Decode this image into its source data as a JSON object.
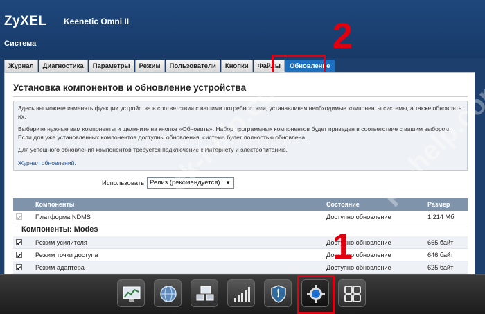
{
  "header": {
    "logo": "ZyXEL",
    "model": "Keenetic Omni II",
    "section": "Система"
  },
  "tabs": [
    {
      "label": "Журнал"
    },
    {
      "label": "Диагностика"
    },
    {
      "label": "Параметры"
    },
    {
      "label": "Режим"
    },
    {
      "label": "Пользователи"
    },
    {
      "label": "Кнопки"
    },
    {
      "label": "Файлы"
    },
    {
      "label": "Обновление"
    }
  ],
  "annotations": {
    "tab_marker": "2",
    "dock_marker": "1",
    "color": "#e00010"
  },
  "main": {
    "heading": "Установка компонентов и обновление устройства",
    "info": {
      "p1": "Здесь вы можете изменять функции устройства в соответствии с вашими потребностями, устанавливая необходимые компоненты системы, а также обновлять их.",
      "p2": "Выберите нужные вам компоненты и щелкните на кнопке «Обновить». Набор программных компонентов будет приведен в соответствие с вашим выбором. Если для уже установленных компонентов доступны обновления, система будет полностью обновлена.",
      "p3": "Для успешного обновления компонентов требуется подключение к Интернету и электропитанию.",
      "link": "Журнал обновлений",
      "link_suffix": "."
    },
    "use_label": "Использовать:",
    "use_value": "Релиз (рекомендуется)"
  },
  "table": {
    "headers": {
      "name": "Компоненты",
      "state": "Состояние",
      "size": "Размер"
    },
    "platform": {
      "name": "Платформа NDMS",
      "state": "Доступно обновление",
      "size": "1.214 Мб"
    },
    "group": "Компоненты: Modes",
    "rows": [
      {
        "name": "Режим усилителя",
        "state": "Доступно обновление",
        "size": "665 байт"
      },
      {
        "name": "Режим точки доступа",
        "state": "Доступно обновление",
        "size": "646 байт"
      },
      {
        "name": "Режим адаптера",
        "state": "Доступно обновление",
        "size": "625 байт"
      }
    ]
  },
  "dock": {
    "icons": [
      "monitor-icon",
      "globe-icon",
      "network-icon",
      "signal-icon",
      "shield-icon",
      "gear-icon",
      "apps-grid-icon"
    ]
  },
  "watermark": "pk-help.com"
}
